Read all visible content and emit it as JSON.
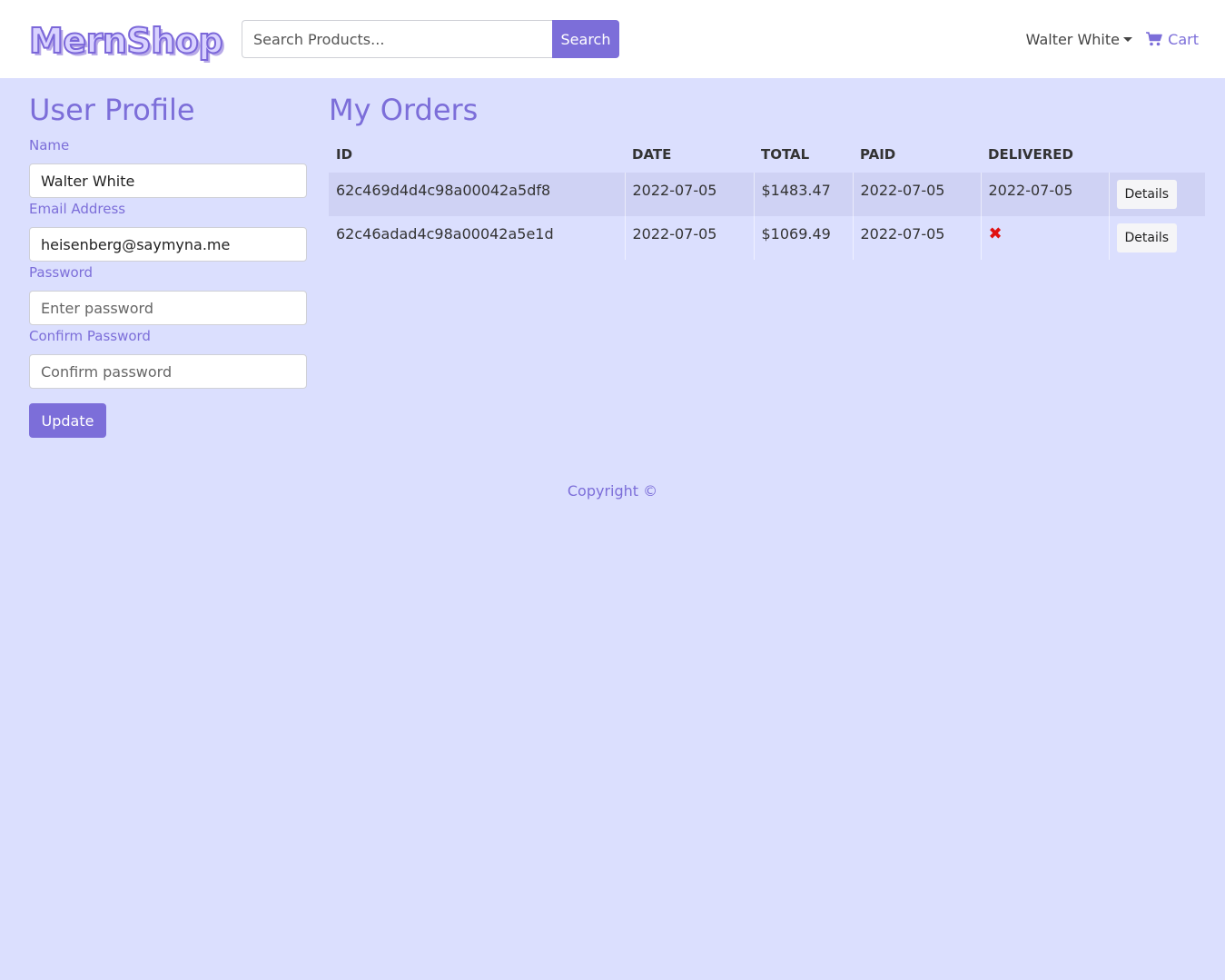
{
  "navbar": {
    "brand": "MernShop",
    "search_placeholder": "Search Products...",
    "search_button": "Search",
    "user_name": "Walter White",
    "cart_label": "Cart"
  },
  "profile": {
    "title": "User Profile",
    "name_label": "Name",
    "name_value": "Walter White",
    "email_label": "Email Address",
    "email_value": "heisenberg@saymyna.me",
    "password_label": "Password",
    "password_placeholder": "Enter password",
    "confirm_label": "Confirm Password",
    "confirm_placeholder": "Confirm password",
    "update_button": "Update"
  },
  "orders": {
    "title": "My Orders",
    "columns": [
      "ID",
      "DATE",
      "TOTAL",
      "PAID",
      "DELIVERED",
      ""
    ],
    "rows": [
      {
        "id": "62c469d4d4c98a00042a5df8",
        "date": "2022-07-05",
        "total": "$1483.47",
        "paid": "2022-07-05",
        "delivered": "2022-07-05",
        "action": "Details"
      },
      {
        "id": "62c46adad4c98a00042a5e1d",
        "date": "2022-07-05",
        "total": "$1069.49",
        "paid": "2022-07-05",
        "delivered": "",
        "action": "Details"
      }
    ]
  },
  "footer": {
    "copyright": "Copyright ©"
  },
  "icons": {
    "cart": "cart-icon",
    "not_delivered": "close-icon",
    "dropdown": "caret-down-icon"
  },
  "colors": {
    "accent": "#7c6ed9",
    "background": "#dbdffe",
    "not_delivered": "#e01010"
  }
}
